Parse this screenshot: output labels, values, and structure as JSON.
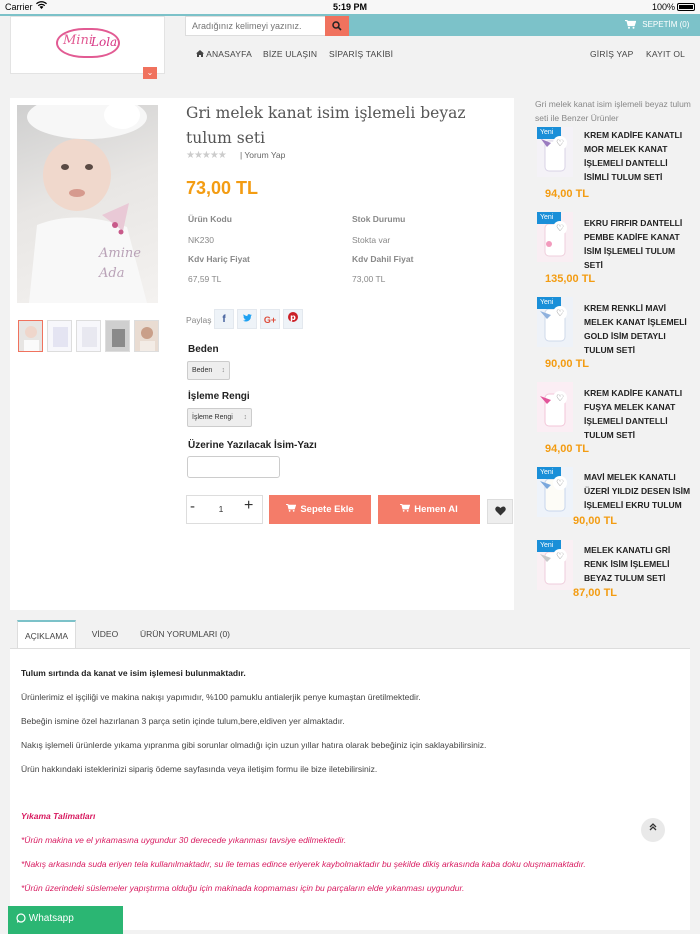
{
  "status_bar": {
    "carrier": "Carrier",
    "time": "5:19 PM",
    "battery": "100%"
  },
  "header": {
    "logo_text_1": "Mini",
    "logo_text_2": "Lola",
    "search_placeholder": "Aradığınız kelimeyi yazınız.",
    "cart_label": "SEPETİM (0)",
    "nav": {
      "home": "ANASAYFA",
      "contact": "BİZE ULAŞIN",
      "order_tracking": "SİPARİŞ TAKİBİ",
      "login": "GİRİŞ YAP",
      "register": "KAYIT OL"
    }
  },
  "product": {
    "title": "Gri melek kanat isim işlemeli beyaz tulum seti",
    "review_link": "| Yorum Yap",
    "price": "73,00 TL",
    "specs": {
      "code_label": "Ürün Kodu",
      "code_value": "NK230",
      "stock_label": "Stok Durumu",
      "stock_value": "Stokta var",
      "excl_label": "Kdv Hariç Fiyat",
      "excl_value": "67,59 TL",
      "incl_label": "Kdv Dahil Fiyat",
      "incl_value": "73,00 TL"
    },
    "share_label": "Paylaş",
    "size_label": "Beden",
    "size_selected": "Beden",
    "embroidery_label": "İşleme Rengi",
    "embroidery_selected": "İşleme Rengi",
    "name_text_label": "Üzerine Yazılacak İsim-Yazı",
    "quantity": "1",
    "add_to_cart": "Sepete Ekle",
    "buy_now": "Hemen Al"
  },
  "similar": {
    "heading": "Gri melek kanat isim işlemeli beyaz tulum seti ile Benzer Ürünler",
    "badge": "Yeni",
    "items": [
      {
        "name": "KREM KADİFE KANATLI MOR MELEK KANAT İŞLEMELİ DANTELLİ İSİMLİ TULUM SETİ",
        "price": "94,00 TL"
      },
      {
        "name": "EKRU FIRFIR DANTELLİ PEMBE KADİFE KANAT İSİM İŞLEMELİ TULUM SETİ",
        "price": "135,00 TL"
      },
      {
        "name": "KREM RENKLİ MAVİ MELEK KANAT İŞLEMELİ GOLD İSİM DETAYLI TULUM SETİ",
        "price": "90,00 TL"
      },
      {
        "name": "KREM KADİFE KANATLI FUŞYA MELEK KANAT İŞLEMELİ DANTELLİ TULUM SETİ",
        "price": "94,00 TL"
      },
      {
        "name": "MAVİ MELEK KANATLI ÜZERİ YILDIZ DESEN İSİM İŞLEMELİ EKRU TULUM",
        "price": "90,00 TL"
      },
      {
        "name": "MELEK KANATLI GRİ RENK İSİM İŞLEMELİ BEYAZ TULUM SETİ",
        "price": "87,00 TL"
      }
    ]
  },
  "tabs": {
    "description": "AÇIKLAMA",
    "video": "VİDEO",
    "reviews": "ÜRÜN YORUMLARI (0)"
  },
  "description": {
    "p1": "Tulum sırtında da kanat ve isim işlemesi bulunmaktadır.",
    "p2": "Ürünlerimiz el işçiliği ve makina nakışı yapımıdır, %100 pamuklu antialerjik penye kumaştan üretilmektedir.",
    "p3": "Bebeğin ismine özel hazırlanan 3 parça setin içinde tulum,bere,eldiven yer almaktadır.",
    "p4": "Nakış işlemeli ürünlerde yıkama yıpranma gibi sorunlar olmadığı için uzun yıllar hatıra olarak bebeğiniz için saklayabilirsiniz.",
    "p5": "Ürün hakkındaki isteklerinizi sipariş ödeme sayfasında veya iletişim formu ile bize iletebilirsiniz.",
    "care_title": "Yıkama Talimatları",
    "care_1": "*Ürün makina ve el yıkamasına uygundur 30 derecede yıkanması tavsiye edilmektedir.",
    "care_2": "*Nakış arkasında suda eriyen tela kullanılmaktadır, su ile temas edince eriyerek kaybolmaktadır bu şekilde dikiş arkasında kaba doku oluşmamaktadır.",
    "care_3": "*Ürün üzerindeki süslemeler yapıştırma olduğu için makinada kopmaması için bu parçaların elde yıkanması uygundur."
  },
  "whatsapp_label": "Whatsapp",
  "colors": {
    "accent": "#f47c69",
    "teal": "#7cc2c9",
    "price": "#f39c12",
    "care_text": "#d81b60",
    "whatsapp": "#2bb673"
  },
  "icons": [
    "wifi-icon",
    "search-icon",
    "cart-icon",
    "chevron-down-icon",
    "home-icon",
    "facebook-icon",
    "twitter-icon",
    "google-plus-icon",
    "pinterest-icon",
    "heart-icon",
    "chevron-up-icon",
    "whatsapp-icon"
  ]
}
